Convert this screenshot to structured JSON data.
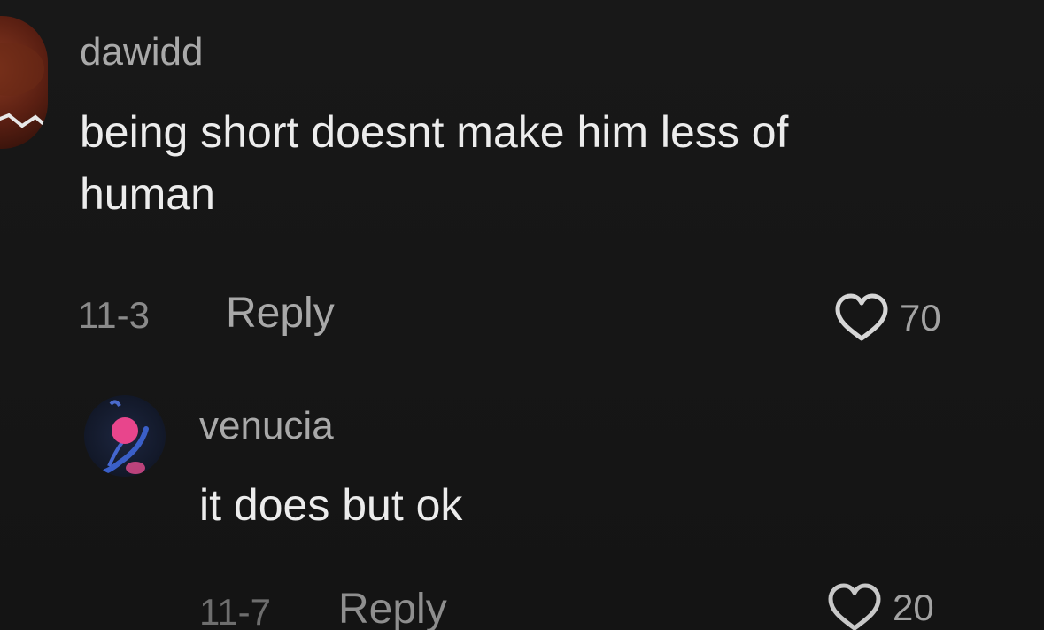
{
  "comments": [
    {
      "username": "dawidd",
      "text_line1": "being short doesnt make him less of",
      "text_line2": "human",
      "date": "11-3",
      "reply_label": "Reply",
      "like_count": "70",
      "like_icon": "heart-outline-icon"
    },
    {
      "username": "venucia",
      "text_line1": "it does but ok",
      "date": "11-7",
      "reply_label": "Reply",
      "like_count": "20",
      "like_icon": "heart-outline-icon"
    }
  ],
  "colors": {
    "background": "#161616",
    "username": "#a9a9a9",
    "text": "#ececec",
    "meta": "#8a8a8a"
  }
}
